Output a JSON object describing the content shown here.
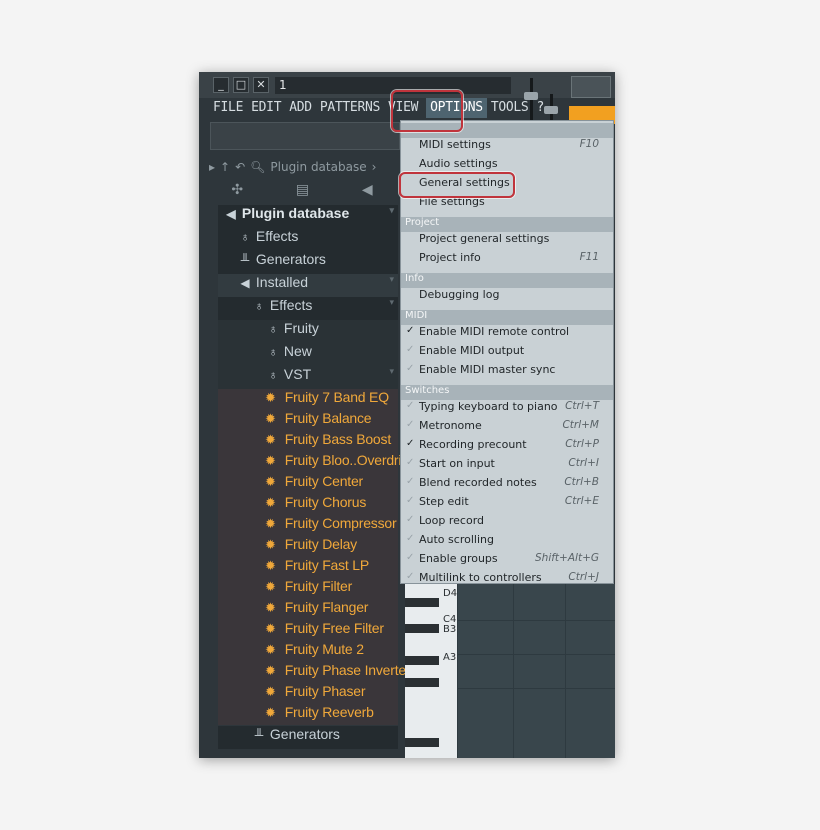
{
  "window": {
    "title": "1",
    "controls": [
      {
        "name": "minimize-button",
        "label": "_"
      },
      {
        "name": "maximize-button",
        "label": "□"
      },
      {
        "name": "close-button",
        "label": "✕"
      }
    ]
  },
  "menubar": [
    "FILE",
    "EDIT",
    "ADD",
    "PATTERNS",
    "VIEW",
    "OPTIONS",
    "TOOLS",
    "?"
  ],
  "browser": {
    "header_label": "Plugin database",
    "tree": [
      {
        "label": "Plugin database",
        "icon": "speaker-icon",
        "style": "root"
      },
      {
        "label": "Effects",
        "icon": "mic-icon",
        "indent": 1
      },
      {
        "label": "Generators",
        "icon": "piano-icon",
        "indent": 1
      },
      {
        "label": "Installed",
        "icon": "speaker-icon",
        "indent": 1
      },
      {
        "label": "Effects",
        "icon": "mic-icon",
        "indent": 2
      },
      {
        "label": "Fruity",
        "icon": "mic-icon",
        "indent": 3
      },
      {
        "label": "New",
        "icon": "mic-icon",
        "indent": 3
      },
      {
        "label": "VST",
        "icon": "mic-icon",
        "indent": 3
      }
    ],
    "plugins": [
      "Fruity 7 Band EQ",
      "Fruity Balance",
      "Fruity Bass Boost",
      "Fruity Bloo..Overdrive",
      "Fruity Center",
      "Fruity Chorus",
      "Fruity Compressor",
      "Fruity Delay",
      "Fruity Fast LP",
      "Fruity Filter",
      "Fruity Flanger",
      "Fruity Free Filter",
      "Fruity Mute 2",
      "Fruity Phase Inverter",
      "Fruity Phaser",
      "Fruity Reeverb"
    ],
    "footer_item": "Generators"
  },
  "piano_keys": [
    "D4",
    "C4",
    "B3",
    "A3"
  ],
  "dropdown": [
    {
      "section": "",
      "items": [
        {
          "label": "MIDI settings",
          "shortcut": "F10"
        },
        {
          "label": "Audio settings",
          "shortcut": ""
        },
        {
          "label": "General settings",
          "shortcut": ""
        },
        {
          "label": "File settings",
          "shortcut": ""
        }
      ]
    },
    {
      "section": "Project",
      "items": [
        {
          "label": "Project general settings",
          "shortcut": ""
        },
        {
          "label": "Project info",
          "shortcut": "F11"
        }
      ]
    },
    {
      "section": "Info",
      "items": [
        {
          "label": "Debugging log",
          "shortcut": ""
        }
      ]
    },
    {
      "section": "MIDI",
      "items": [
        {
          "label": "Enable MIDI remote control",
          "shortcut": "",
          "checked": true
        },
        {
          "label": "Enable MIDI output",
          "shortcut": "",
          "checked": false
        },
        {
          "label": "Enable MIDI master sync",
          "shortcut": "",
          "checked": false
        }
      ]
    },
    {
      "section": "Switches",
      "items": [
        {
          "label": "Typing keyboard to piano",
          "shortcut": "Ctrl+T",
          "checked": false
        },
        {
          "label": "Metronome",
          "shortcut": "Ctrl+M",
          "checked": false
        },
        {
          "label": "Recording precount",
          "shortcut": "Ctrl+P",
          "checked": true
        },
        {
          "label": "Start on input",
          "shortcut": "Ctrl+I",
          "checked": false
        },
        {
          "label": "Blend recorded notes",
          "shortcut": "Ctrl+B",
          "checked": false
        },
        {
          "label": "Step edit",
          "shortcut": "Ctrl+E",
          "checked": false
        },
        {
          "label": "Loop record",
          "shortcut": "",
          "checked": false
        },
        {
          "label": "Auto scrolling",
          "shortcut": "",
          "checked": false
        },
        {
          "label": "Enable groups",
          "shortcut": "Shift+Alt+G",
          "checked": false
        },
        {
          "label": "Multilink to controllers",
          "shortcut": "Ctrl+J",
          "checked": false
        }
      ]
    }
  ],
  "colors": {
    "highlight": "#c0343c",
    "plugin_text": "#f0a83a",
    "menu_bg": "#c9d1d5"
  }
}
